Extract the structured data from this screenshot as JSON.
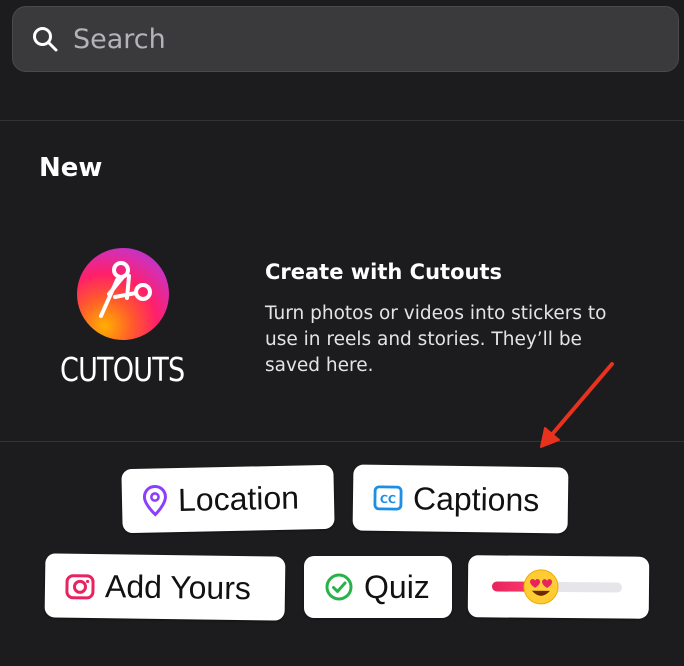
{
  "search": {
    "placeholder": "Search"
  },
  "section": {
    "title": "New"
  },
  "promo": {
    "logo_label": "CUTOUTS",
    "title": "Create with Cutouts",
    "body": "Turn photos or videos into stickers to use in reels and stories. They’ll be saved here."
  },
  "stickers": {
    "location": {
      "label": "Location",
      "icon": "location-pin-icon",
      "color": "#8a3ffc"
    },
    "captions": {
      "label": "Captions",
      "icon": "cc-icon",
      "color": "#1b8fe6"
    },
    "add_yours": {
      "label": "Add Yours",
      "icon": "camera-icon",
      "color": "#e8245e"
    },
    "quiz": {
      "label": "Quiz",
      "icon": "check-circle-icon",
      "color": "#27b34a"
    },
    "slider": {
      "icon": "heart-eyes-emoji-icon",
      "level": 0.38,
      "color": "#e8245e"
    }
  },
  "colors": {
    "background": "#1c1c1e",
    "search_bg": "#3a3a3c",
    "annotation_arrow": "#e8321e"
  }
}
